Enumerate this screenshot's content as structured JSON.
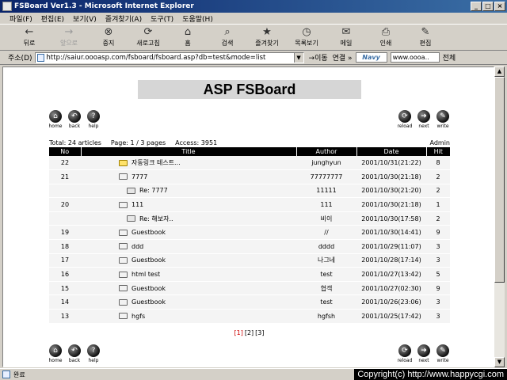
{
  "window": {
    "title": "FSBoard Ver1.3 - Microsoft Internet Explorer"
  },
  "menu": [
    "파일(F)",
    "편집(E)",
    "보기(V)",
    "즐겨찾기(A)",
    "도구(T)",
    "도움말(H)"
  ],
  "toolbar": [
    {
      "label": "뒤로",
      "icon": "←",
      "disabled": false
    },
    {
      "label": "앞으로",
      "icon": "→",
      "disabled": true
    },
    {
      "label": "중지",
      "icon": "⊗",
      "disabled": false
    },
    {
      "label": "새로고침",
      "icon": "⟳",
      "disabled": false
    },
    {
      "label": "홈",
      "icon": "⌂",
      "disabled": false
    },
    {
      "label": "검색",
      "icon": "⌕",
      "disabled": false
    },
    {
      "label": "즐겨찾기",
      "icon": "★",
      "disabled": false
    },
    {
      "label": "목록보기",
      "icon": "◷",
      "disabled": false
    },
    {
      "label": "메일",
      "icon": "✉",
      "disabled": false
    },
    {
      "label": "인쇄",
      "icon": "⎙",
      "disabled": false
    },
    {
      "label": "편집",
      "icon": "✎",
      "disabled": false
    }
  ],
  "address": {
    "label": "주소(D)",
    "url": "http://saiur.oooasp.com/fsboard/fsboard.asp?db=test&mode=list",
    "go": "이동",
    "links": "연결 »",
    "navy_logo": "Navy",
    "navy_input": "www.oooa..",
    "navy_all": "전체"
  },
  "page": {
    "board_title": "ASP FSBoard",
    "nav_left": [
      "home",
      "back",
      "help"
    ],
    "nav_right": [
      "reload",
      "next",
      "write"
    ],
    "total": "Total: 24 articles",
    "page_info": "Page: 1 / 3 pages",
    "access": "Access: 3951",
    "admin": "Admin",
    "columns": [
      "No",
      "Title",
      "Author",
      "Date",
      "Hit"
    ],
    "rows": [
      {
        "no": "22",
        "title": "자동링크 테스트...",
        "author": "junghyun",
        "date": "2001/10/31(21:22)",
        "hit": "8",
        "reply": false,
        "open": true
      },
      {
        "no": "21",
        "title": "7777",
        "author": "77777777",
        "date": "2001/10/30(21:18)",
        "hit": "2",
        "reply": false,
        "open": false
      },
      {
        "no": "",
        "title": "Re: 7777",
        "author": "11111",
        "date": "2001/10/30(21:20)",
        "hit": "2",
        "reply": true,
        "open": false
      },
      {
        "no": "20",
        "title": "111",
        "author": "111",
        "date": "2001/10/30(21:18)",
        "hit": "1",
        "reply": false,
        "open": false
      },
      {
        "no": "",
        "title": "Re: 해보자..",
        "author": "비이",
        "date": "2001/10/30(17:58)",
        "hit": "2",
        "reply": true,
        "open": false
      },
      {
        "no": "19",
        "title": "Guestbook",
        "author": "//",
        "date": "2001/10/30(14:41)",
        "hit": "9",
        "reply": false,
        "open": false
      },
      {
        "no": "18",
        "title": "ddd",
        "author": "dddd",
        "date": "2001/10/29(11:07)",
        "hit": "3",
        "reply": false,
        "open": false
      },
      {
        "no": "17",
        "title": "Guestbook",
        "author": "나그네",
        "date": "2001/10/28(17:14)",
        "hit": "3",
        "reply": false,
        "open": false
      },
      {
        "no": "16",
        "title": "html test",
        "author": "test",
        "date": "2001/10/27(13:42)",
        "hit": "5",
        "reply": false,
        "open": false
      },
      {
        "no": "15",
        "title": "Guestbook",
        "author": "협객",
        "date": "2001/10/27(02:30)",
        "hit": "9",
        "reply": false,
        "open": false
      },
      {
        "no": "14",
        "title": "Guestbook",
        "author": "test",
        "date": "2001/10/26(23:06)",
        "hit": "3",
        "reply": false,
        "open": false
      },
      {
        "no": "13",
        "title": "hgfs",
        "author": "hgfsh",
        "date": "2001/10/25(17:42)",
        "hit": "3",
        "reply": false,
        "open": false
      }
    ],
    "pages": [
      "[1]",
      "[2]",
      "[3]"
    ],
    "current_page": "[1]"
  },
  "status": {
    "text": "완료",
    "copyright": "Copyright(c) http://www.happycgi.com"
  },
  "colors": {
    "title_bar": "#0a246a",
    "header_bg": "#000000",
    "row_bg": "#f4f4f4",
    "current_page": "#cc0000"
  }
}
